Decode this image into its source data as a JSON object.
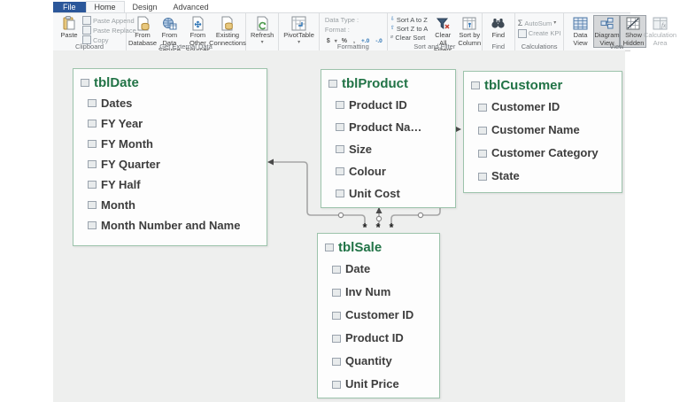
{
  "ribbon": {
    "tabs": [
      {
        "label": "File"
      },
      {
        "label": "Home"
      },
      {
        "label": "Design"
      },
      {
        "label": "Advanced"
      }
    ],
    "clipboard": {
      "label": "Clipboard",
      "paste": "Paste",
      "paste_append": "Paste Append",
      "paste_replace": "Paste Replace",
      "copy": "Copy"
    },
    "external": {
      "label": "Get External Data",
      "from_database": "From Database",
      "from_data_service": "From Data Service",
      "from_other_sources": "From Other Sources",
      "existing_connections": "Existing Connections"
    },
    "refresh": {
      "label": "Refresh"
    },
    "pivottable": {
      "label": "PivotTable"
    },
    "formatting": {
      "label": "Formatting",
      "data_type": "Data Type :",
      "format": "Format :",
      "currency": "$",
      "percent": "%",
      "thousands": ",",
      "inc_decimal": "+.0",
      "dec_decimal": "-.0"
    },
    "sort": {
      "label": "Sort and Filter",
      "a_to_z": "Sort A to Z",
      "z_to_a": "Sort Z to A",
      "clear_sort": "Clear Sort",
      "clear_all_filters": "Clear All Filters",
      "sort_by_column": "Sort by Column"
    },
    "find": {
      "label": "Find",
      "button": "Find"
    },
    "calculations": {
      "label": "Calculations",
      "autosum": "AutoSum",
      "create_kpi": "Create KPI"
    },
    "view": {
      "label": "View",
      "data_view": "Data View",
      "diagram_view": "Diagram View",
      "show_hidden": "Show Hidden",
      "calculation_area": "Calculation Area"
    }
  },
  "diagram": {
    "cardinality_many": "*",
    "tables": [
      {
        "name": "tblDate",
        "fields": [
          "Dates",
          "FY Year",
          "FY Month",
          "FY Quarter",
          "FY Half",
          "Month",
          "Month Number and Name"
        ]
      },
      {
        "name": "tblProduct",
        "fields": [
          "Product ID",
          "Product Na…",
          "Size",
          "Colour",
          "Unit Cost"
        ]
      },
      {
        "name": "tblCustomer",
        "fields": [
          "Customer ID",
          "Customer Name",
          "Customer Category",
          "State"
        ]
      },
      {
        "name": "tblSale",
        "fields": [
          "Date",
          "Inv Num",
          "Customer ID",
          "Product ID",
          "Quantity",
          "Unit Price"
        ]
      }
    ],
    "relationships": [
      {
        "from": "tblSale",
        "to": "tblDate",
        "type": "many-to-one"
      },
      {
        "from": "tblSale",
        "to": "tblProduct",
        "type": "many-to-one"
      },
      {
        "from": "tblSale",
        "to": "tblCustomer",
        "type": "many-to-one"
      }
    ]
  },
  "colors": {
    "header_green": "#217346",
    "box_border": "#9cc3ab",
    "file_tab_blue": "#2b579a",
    "relationship_line": "#a5a5a5"
  }
}
